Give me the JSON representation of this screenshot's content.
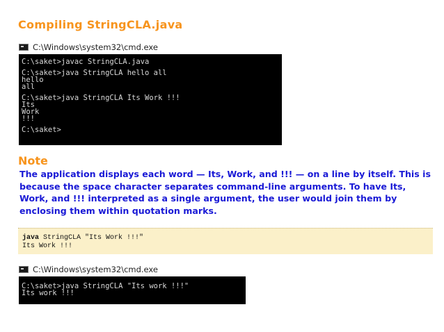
{
  "title": "Compiling StringCLA.java",
  "window1": {
    "title": "C:\\Windows\\system32\\cmd.exe",
    "lines": [
      "C:\\saket>javac StringCLA.java",
      "",
      "C:\\saket>java StringCLA hello all",
      "hello",
      "all",
      "",
      "C:\\saket>java StringCLA Its Work !!!",
      "Its",
      "Work",
      "!!!",
      "",
      "C:\\saket>"
    ]
  },
  "note": {
    "heading": "Note",
    "text": "The application displays each word — Its, Work, and !!! — on a line by itself. This is because the space character separates command-line arguments. To have Its, Work, and !!! interpreted as a single argument, the user would join them by enclosing them within quotation marks."
  },
  "code": {
    "keyword": "java",
    "command_rest": " StringCLA \"Its Work !!!\"",
    "output": "Its Work !!!"
  },
  "window2": {
    "title": "C:\\Windows\\system32\\cmd.exe",
    "lines": [
      "C:\\saket>java StringCLA \"Its work !!!\"",
      "Its work !!!"
    ]
  },
  "colors": {
    "heading": "#f7941d",
    "note_text": "#1a1ad6",
    "code_background": "#fbf0c9",
    "console_background": "#000000"
  }
}
